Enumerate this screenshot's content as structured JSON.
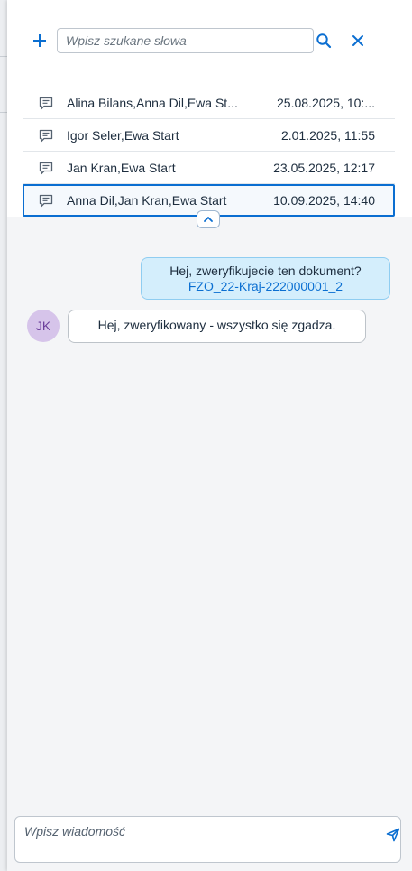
{
  "search": {
    "placeholder": "Wpisz szukane słowa"
  },
  "conversations": [
    {
      "title": "Alina Bilans,Anna Dil,Ewa St...",
      "date": "25.08.2025, 10:..."
    },
    {
      "title": "Igor Seler,Ewa Start",
      "date": "2.01.2025, 11:55"
    },
    {
      "title": "Jan Kran,Ewa Start",
      "date": "23.05.2025, 12:17"
    },
    {
      "title": "Anna Dil,Jan Kran,Ewa Start",
      "date": "10.09.2025, 14:40",
      "selected": true
    }
  ],
  "messages": {
    "outgoing": {
      "text": "Hej, zweryfikujecie ten dokument?",
      "link": "FZO_22-Kraj-222000001_2"
    },
    "incoming": {
      "avatar_initials": "JK",
      "text": "Hej, zweryfikowany - wszystko się zgadza."
    }
  },
  "composer": {
    "placeholder": "Wpisz wiadomość"
  },
  "icons": {
    "add": "plus-icon",
    "search": "search-icon",
    "close": "close-icon",
    "conversation": "chat-bubble-icon",
    "collapse": "chevron-up-icon",
    "send": "send-icon"
  },
  "colors": {
    "accent": "#0a6ed1",
    "outgoing_bubble": "#d4eefc",
    "avatar": "#d6c4ea"
  }
}
